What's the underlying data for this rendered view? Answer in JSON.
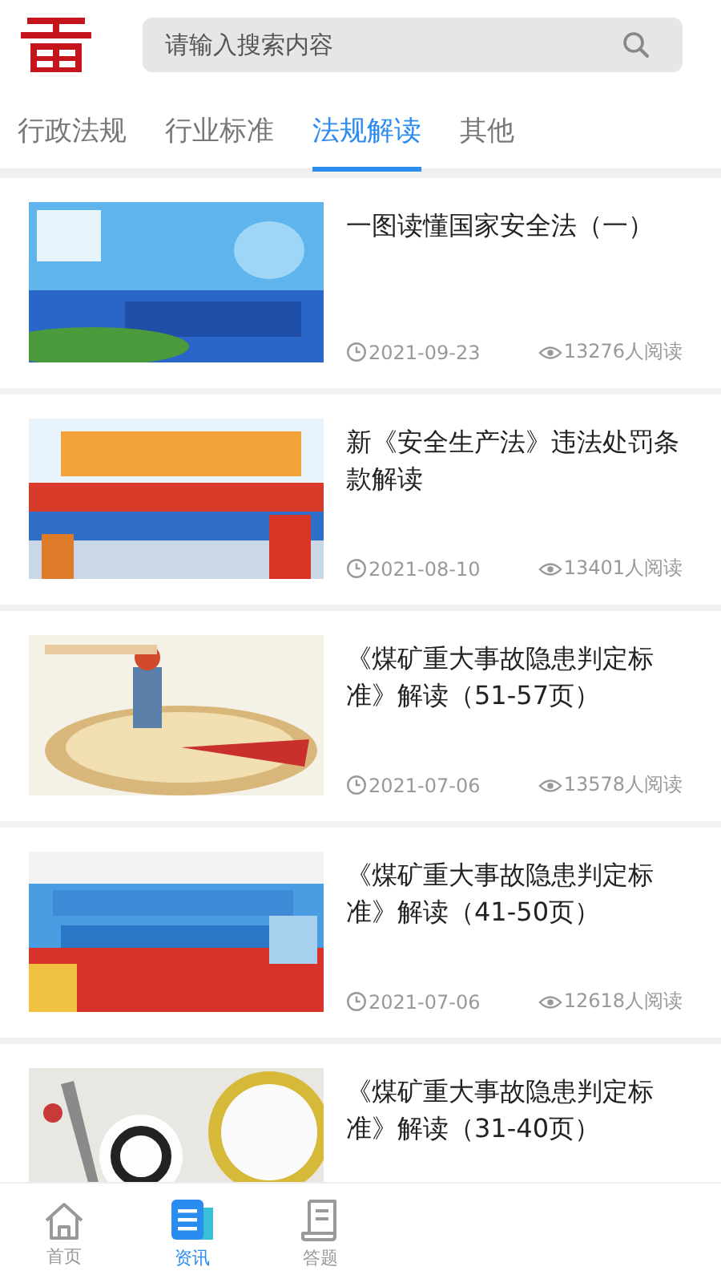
{
  "header": {
    "search": {
      "placeholder": "请输入搜索内容"
    }
  },
  "tabs": [
    {
      "label": "行政法规",
      "selected": false
    },
    {
      "label": "行业标准",
      "selected": false
    },
    {
      "label": "法规解读",
      "selected": true
    },
    {
      "label": "其他",
      "selected": false
    }
  ],
  "articles": [
    {
      "title": "一图读懂国家安全法（一）",
      "date": "2021-09-23",
      "reads": "13276人阅读"
    },
    {
      "title": "新《安全生产法》违法处罚条款解读",
      "date": "2021-08-10",
      "reads": "13401人阅读"
    },
    {
      "title": "《煤矿重大事故隐患判定标准》解读（51-57页）",
      "date": "2021-07-06",
      "reads": "13578人阅读"
    },
    {
      "title": "《煤矿重大事故隐患判定标准》解读（41-50页）",
      "date": "2021-07-06",
      "reads": "12618人阅读"
    },
    {
      "title": "《煤矿重大事故隐患判定标准》解读（31-40页）"
    }
  ],
  "bottom_nav": [
    {
      "label": "首页",
      "kind": "home",
      "selected": false
    },
    {
      "label": "资讯",
      "kind": "news",
      "selected": true
    },
    {
      "label": "答题",
      "kind": "quiz",
      "selected": false
    }
  ]
}
